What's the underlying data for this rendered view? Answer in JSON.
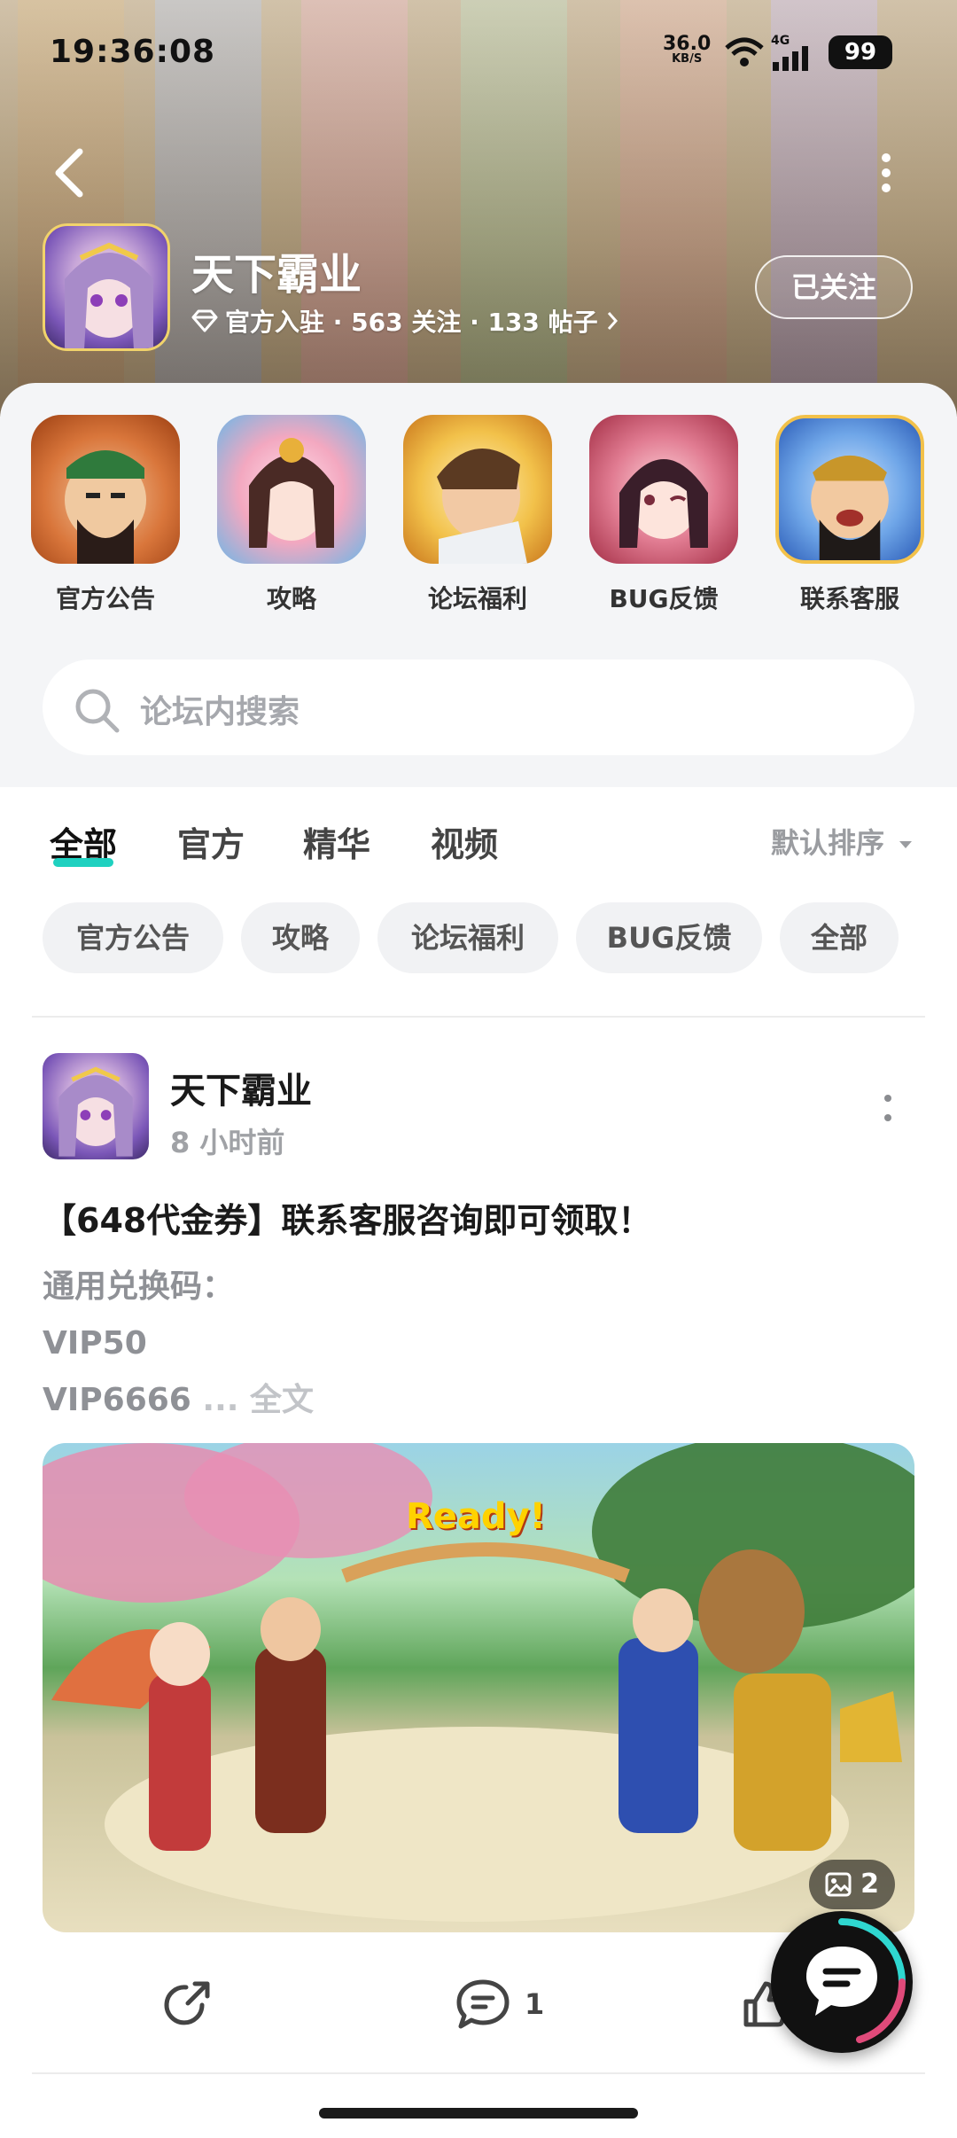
{
  "status_bar": {
    "time": "19:36:08",
    "net_speed": "36.0",
    "net_unit": "KB/S",
    "network": "4G",
    "battery": "99"
  },
  "header": {
    "icons": {
      "back": "back-arrow-icon",
      "more": "more-vertical-icon"
    },
    "forum_name": "天下霸业",
    "meta_badge_icon": "diamond-icon",
    "meta": "官方入驻 · 563 关注 · 133 帖子",
    "follow_button": "已关注"
  },
  "quick_entries": [
    {
      "label": "官方公告",
      "color": "#c2541a"
    },
    {
      "label": "攻略",
      "color": "#e6a2b8"
    },
    {
      "label": "论坛福利",
      "color": "#e4a33a"
    },
    {
      "label": "BUG反馈",
      "color": "#a8323f"
    },
    {
      "label": "联系客服",
      "color": "#3f7fd6"
    }
  ],
  "search": {
    "placeholder": "论坛内搜索",
    "icon": "search-icon"
  },
  "tabs": [
    {
      "label": "全部",
      "active": true
    },
    {
      "label": "官方",
      "active": false
    },
    {
      "label": "精华",
      "active": false
    },
    {
      "label": "视频",
      "active": false
    }
  ],
  "sort": {
    "label": "默认排序",
    "icon": "caret-down-icon"
  },
  "accent_color": "#1fd1c0",
  "chips": [
    "官方公告",
    "攻略",
    "论坛福利",
    "BUG反馈",
    "全部"
  ],
  "post": {
    "author": "天下霸业",
    "time": "8 小时前",
    "title": "【648代金券】联系客服咨询即可领取！",
    "body_lines": [
      "通用兑换码：",
      "VIP50",
      "VIP6666"
    ],
    "more_link": "... 全文",
    "image_overlay_text": "Ready!",
    "image_count": "2",
    "comment_count": "1"
  }
}
